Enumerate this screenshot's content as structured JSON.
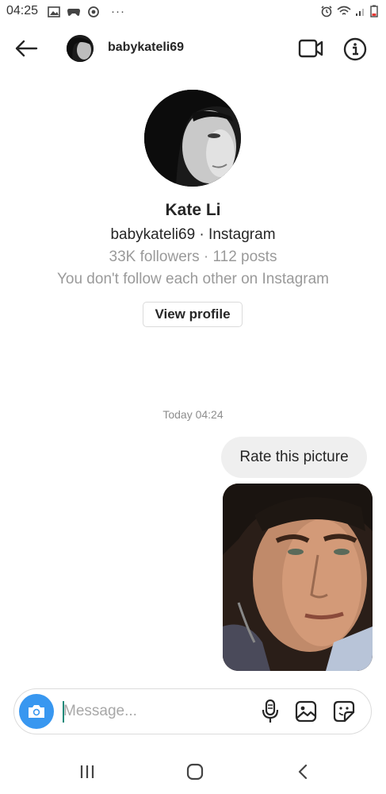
{
  "status_bar": {
    "time": "04:25",
    "more": "···"
  },
  "header": {
    "username": "babykateli69"
  },
  "profile": {
    "name": "Kate Li",
    "handle_line": "babykateli69 · Instagram",
    "stats_line": "33K followers · 112 posts",
    "follow_line": "You don't follow each other on Instagram",
    "view_profile_label": "View profile"
  },
  "conversation": {
    "timestamp": "Today 04:24",
    "messages": [
      {
        "type": "text",
        "text": "Rate this picture"
      },
      {
        "type": "image",
        "subject": "photo of a young man's face"
      }
    ]
  },
  "composer": {
    "placeholder": "Message..."
  },
  "colors": {
    "accent": "#3897f0",
    "bubble": "#efefef",
    "muted_text": "#9a9a9a"
  }
}
